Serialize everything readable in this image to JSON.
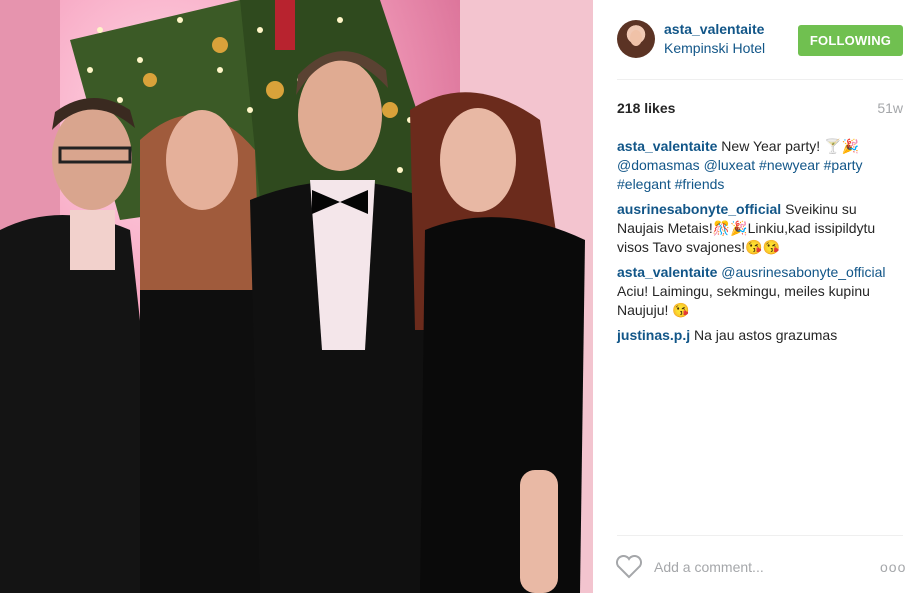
{
  "post": {
    "photo_alt": "",
    "username": "asta_valentaite",
    "location": "Kempinski Hotel",
    "follow_label": "FOLLOWING",
    "likes": "218 likes",
    "age": "51w",
    "add_comment_placeholder": "Add a comment...",
    "more_label": "ooo"
  },
  "comments": [
    {
      "user": "asta_valentaite",
      "text": "New Year party! 🍸🎉",
      "tags": "@domasmas @luxeat #newyear #party #elegant #friends"
    },
    {
      "user": "ausrinesabonyte_official",
      "text": "Sveikinu su Naujais Metais!🎊🎉Linkiu,kad issipildytu visos Tavo svajones!😘😘"
    },
    {
      "user": "asta_valentaite",
      "mention": "@ausrinesabonyte_official",
      "text": "Aciu! Laimingu, sekmingu, meiles kupinu Naujuju! 😘"
    },
    {
      "user": "justinas.p.j",
      "text": "Na jau astos grazumas"
    }
  ]
}
